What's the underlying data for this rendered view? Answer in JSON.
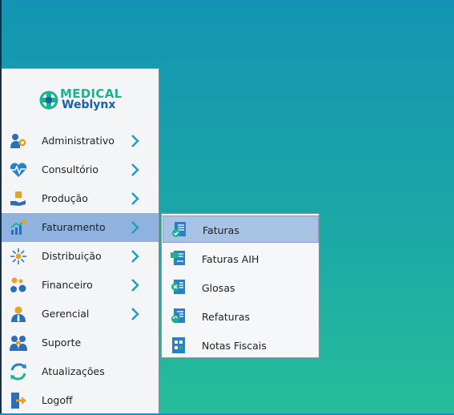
{
  "logo": {
    "line1": "MEDICAL",
    "line2": "Weblynx"
  },
  "menu": {
    "items": [
      {
        "label": "Administrativo",
        "icon": "people-gear-icon",
        "has_submenu": true
      },
      {
        "label": "Consultório",
        "icon": "heart-pulse-icon",
        "has_submenu": true
      },
      {
        "label": "Produção",
        "icon": "hand-box-icon",
        "has_submenu": true
      },
      {
        "label": "Faturamento",
        "icon": "chart-bars-icon",
        "has_submenu": true,
        "active": true
      },
      {
        "label": "Distribuição",
        "icon": "network-icon",
        "has_submenu": true
      },
      {
        "label": "Financeiro",
        "icon": "coins-icon",
        "has_submenu": true
      },
      {
        "label": "Gerencial",
        "icon": "manager-icon",
        "has_submenu": true
      },
      {
        "label": "Suporte",
        "icon": "support-icon",
        "has_submenu": false
      },
      {
        "label": "Atualizações",
        "icon": "refresh-icon",
        "has_submenu": false
      },
      {
        "label": "Logoff",
        "icon": "logoff-icon",
        "has_submenu": false
      }
    ]
  },
  "submenu": {
    "items": [
      {
        "label": "Faturas",
        "icon": "invoice-check-icon",
        "active": true
      },
      {
        "label": "Faturas AIH",
        "icon": "invoice-aih-icon"
      },
      {
        "label": "Glosas",
        "icon": "invoice-x-icon"
      },
      {
        "label": "Refaturas",
        "icon": "invoice-redo-icon"
      },
      {
        "label": "Notas Fiscais",
        "icon": "fiscal-note-icon"
      }
    ]
  },
  "colors": {
    "accent": "#1a9fc4",
    "active_bg": "#8fb3de",
    "sub_active_bg": "#a9c3e6"
  }
}
